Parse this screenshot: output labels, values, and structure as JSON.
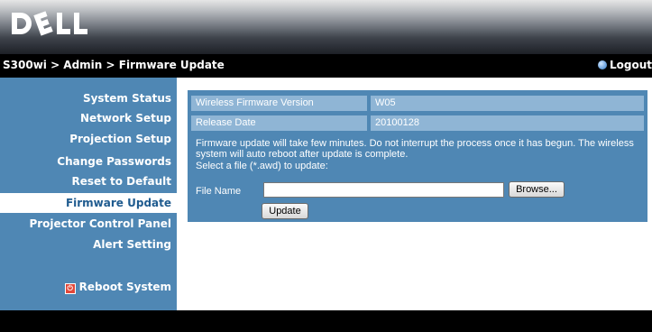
{
  "brand": {
    "logo_text": "DELL"
  },
  "titlebar": {
    "breadcrumb": "S300wi > Admin > Firmware Update",
    "logout_label": "Logout"
  },
  "sidebar": {
    "items": [
      {
        "label": "System Status"
      },
      {
        "label": "Network Setup"
      },
      {
        "label": "Projection Setup"
      },
      {
        "label": "Change Passwords"
      },
      {
        "label": "Reset to Default"
      },
      {
        "label": "Firmware Update",
        "active": true
      },
      {
        "label": "Projector Control Panel"
      },
      {
        "label": "Alert Setting"
      }
    ],
    "reboot_label": "Reboot System"
  },
  "firmware": {
    "version_label": "Wireless Firmware Version",
    "version_value": "W05",
    "date_label": "Release Date",
    "date_value": "20100128",
    "message": "Firmware update will take few minutes. Do not interrupt the process once it has begun. The wireless system will auto reboot after update is complete.",
    "select_prompt": "Select a file (*.awd) to update:",
    "file_name_label": "File Name",
    "file_name_value": "",
    "browse_label": "Browse...",
    "update_label": "Update"
  },
  "colors": {
    "panel": "#4f87b4",
    "cell": "#8fb5d5",
    "active_text": "#1f5b8f",
    "bar": "#000000"
  }
}
